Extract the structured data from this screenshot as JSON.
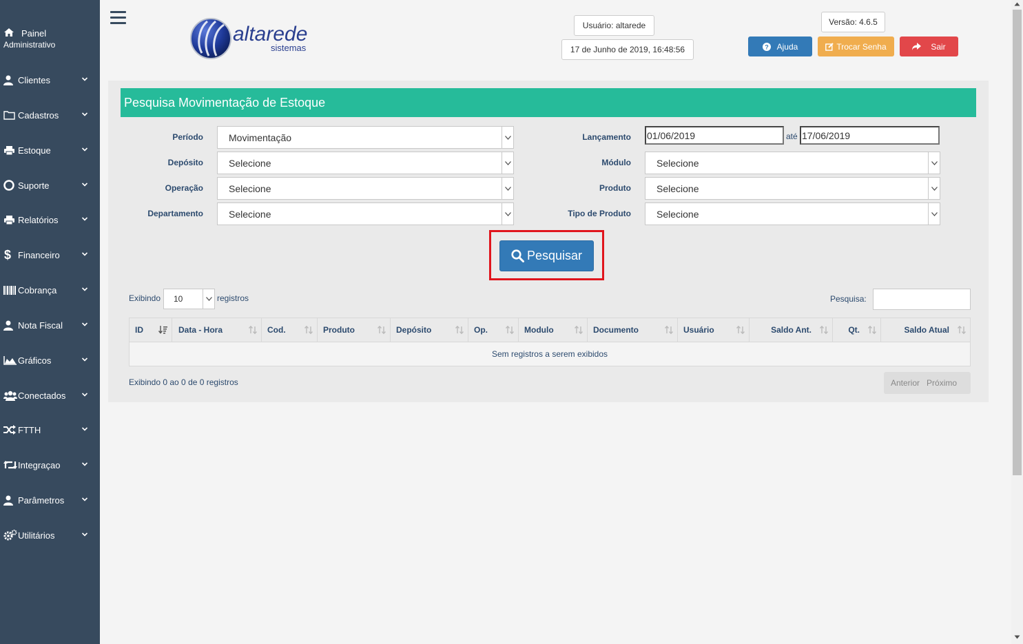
{
  "sidebar": {
    "items": [
      {
        "label_line1": "Painel",
        "label_line2": "Administrativo",
        "icon": "home-icon"
      },
      {
        "label": "Clientes",
        "icon": "user-icon"
      },
      {
        "label": "Cadastros",
        "icon": "folder-icon"
      },
      {
        "label": "Estoque",
        "icon": "print-icon"
      },
      {
        "label": "Suporte",
        "icon": "lifebuoy-icon"
      },
      {
        "label": "Relatórios",
        "icon": "print-icon"
      },
      {
        "label": "Financeiro",
        "icon": "dollar-icon"
      },
      {
        "label": "Cobrança",
        "icon": "barcode-icon"
      },
      {
        "label": "Nota Fiscal",
        "icon": "user-icon"
      },
      {
        "label": "Gráficos",
        "icon": "area-chart-icon"
      },
      {
        "label": "Conectados",
        "icon": "users-icon"
      },
      {
        "label": "FTTH",
        "icon": "random-icon"
      },
      {
        "label": "Integraçao",
        "icon": "retweet-icon"
      },
      {
        "label": "Parâmetros",
        "icon": "user-icon"
      },
      {
        "label": "Utilitários",
        "icon": "cogs-icon"
      }
    ]
  },
  "header": {
    "logo_text": "altarede",
    "logo_sub": "sistemas",
    "user": "Usuário: altarede",
    "datetime": "17 de Junho de 2019, 16:48:56",
    "version": "Versão: 4.6.5",
    "help_label": "Ajuda",
    "change_password_label": "Trocar Senha",
    "logout_label": "Sair"
  },
  "colors": {
    "sidebar": "#374a5e",
    "panel_title": "#26bb9a",
    "help": "#337ab7",
    "change_password": "#f0ad4e",
    "logout": "#e2474a",
    "highlight": "#e0151d"
  },
  "form": {
    "title": "Pesquisa Movimentação de Estoque",
    "periodo_label": "Período",
    "periodo_value": "Movimentação",
    "deposito_label": "Depósito",
    "deposito_value": "Selecione",
    "operacao_label": "Operação",
    "operacao_value": "Selecione",
    "departamento_label": "Departamento",
    "departamento_value": "Selecione",
    "lancamento_label": "Lançamento",
    "date_from": "01/06/2019",
    "ate_label": "até",
    "date_to": "17/06/2019",
    "modulo_label": "Módulo",
    "modulo_value": "Selecione",
    "produto_label": "Produto",
    "produto_value": "Selecione",
    "tipo_produto_label": "Tipo de Produto",
    "tipo_produto_value": "Selecione",
    "search_button": "Pesquisar"
  },
  "table": {
    "show_label": "Exibindo",
    "page_size": "10",
    "records_label": "registros",
    "search_label": "Pesquisa:",
    "columns": [
      "ID",
      "Data - Hora",
      "Cod.",
      "Produto",
      "Depósito",
      "Op.",
      "Modulo",
      "Documento",
      "Usuário",
      "Saldo Ant.",
      "Qt.",
      "Saldo Atual"
    ],
    "empty_message": "Sem registros a serem exibidos",
    "info": "Exibindo 0 ao 0 de 0 registros",
    "prev_label": "Anterior",
    "next_label": "Próximo"
  }
}
